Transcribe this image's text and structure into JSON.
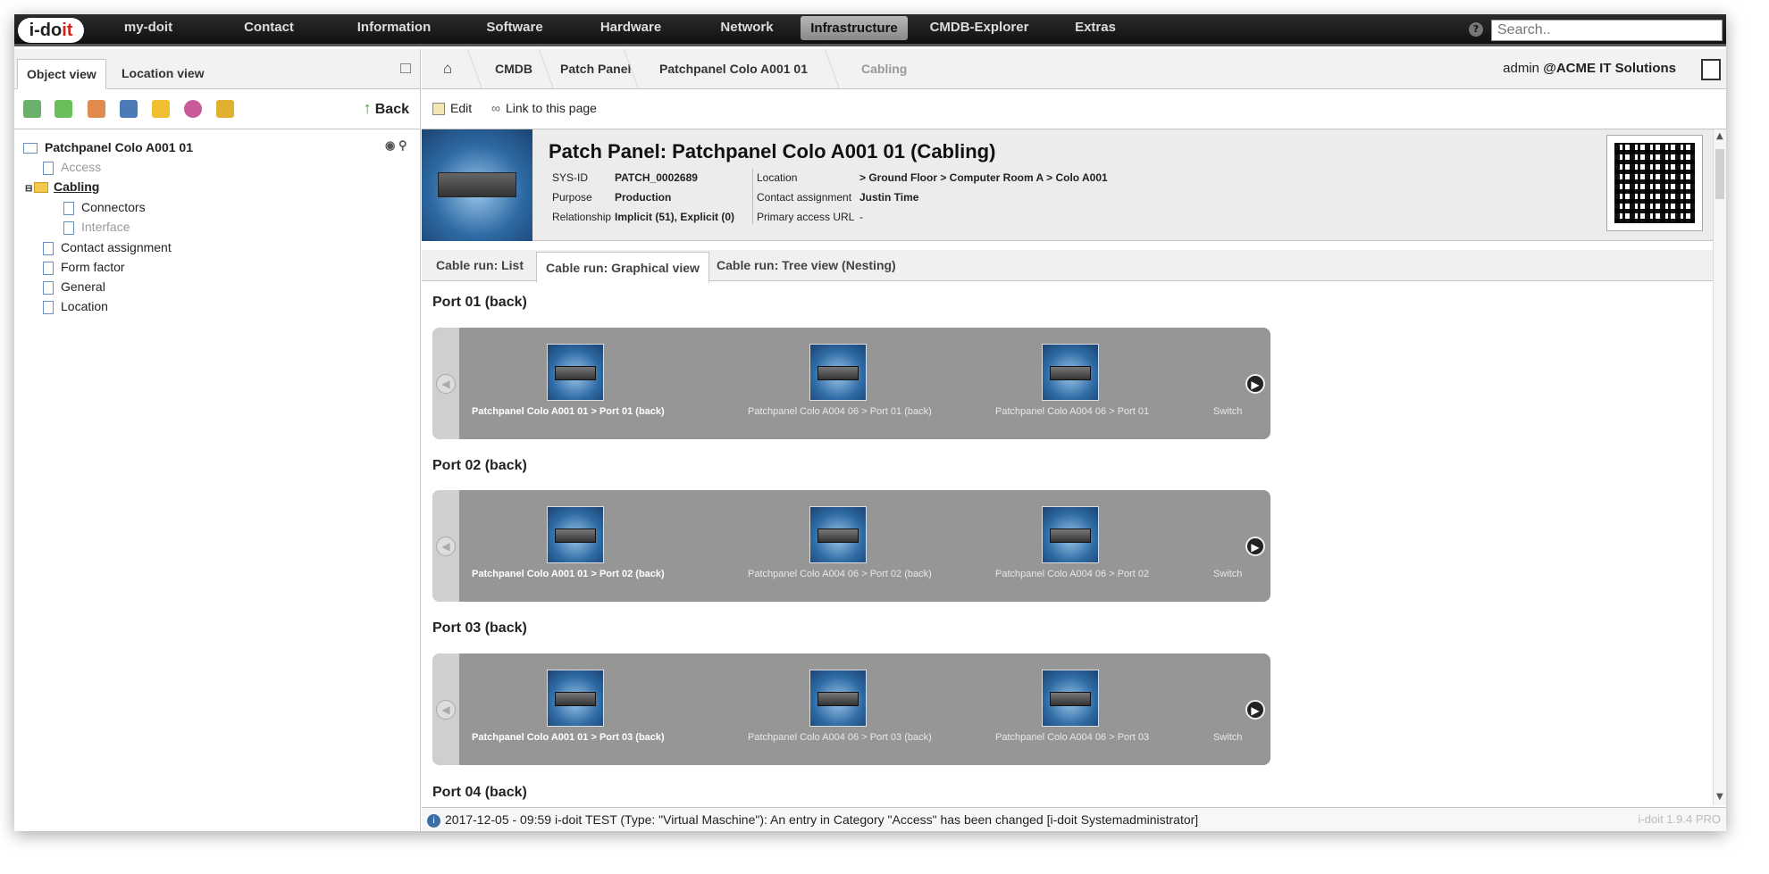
{
  "app": {
    "logo_main": "i-do",
    "logo_accent": "it"
  },
  "nav": {
    "items": [
      "my-doit",
      "Contact",
      "Information",
      "Software",
      "Hardware",
      "Network",
      "Infrastructure",
      "CMDB-Explorer",
      "Extras"
    ],
    "active": "Infrastructure",
    "search_placeholder": "Search..",
    "help": "?"
  },
  "left": {
    "tabs": [
      "Object view",
      "Location view"
    ],
    "back_label": "Back",
    "tree": {
      "root": "Patchpanel Colo A001 01",
      "items": [
        {
          "label": "Access",
          "disabled": true
        },
        {
          "label": "Cabling",
          "active": true
        },
        {
          "label": "Connectors"
        },
        {
          "label": "Interface",
          "disabled": true
        },
        {
          "label": "Contact assignment"
        },
        {
          "label": "Form factor"
        },
        {
          "label": "General"
        },
        {
          "label": "Location"
        }
      ]
    }
  },
  "breadcrumb": [
    "CMDB",
    "Patch Panel",
    "Patchpanel Colo A001 01",
    "Cabling"
  ],
  "user": {
    "name": "admin",
    "tenant": "@ACME IT Solutions"
  },
  "actions": {
    "edit": "Edit",
    "link": "Link to this page"
  },
  "object": {
    "title": "Patch Panel: Patchpanel Colo A001 01 (Cabling)",
    "fields": {
      "sysid_label": "SYS-ID",
      "sysid": "PATCH_0002689",
      "purpose_label": "Purpose",
      "purpose": "Production",
      "relationship_label": "Relationship",
      "relationship": "Implicit (51), Explicit (0)",
      "location_label": "Location",
      "location": "> Ground Floor > Computer Room A > Colo A001",
      "contact_label": "Contact assignment",
      "contact": "Justin Time",
      "url_label": "Primary access URL",
      "url": "-"
    }
  },
  "content_tabs": [
    "Cable run: List",
    "Cable run: Graphical view",
    "Cable run: Tree view (Nesting)"
  ],
  "ports": [
    {
      "title": "Port 01 (back)",
      "labels": [
        "Patchpanel Colo A001 01 > Port 01 (back)",
        "Patchpanel Colo A004 06 > Port 01 (back)",
        "Patchpanel Colo A004 06 > Port 01",
        "Switch"
      ]
    },
    {
      "title": "Port 02 (back)",
      "labels": [
        "Patchpanel Colo A001 01 > Port 02 (back)",
        "Patchpanel Colo A004 06 > Port 02 (back)",
        "Patchpanel Colo A004 06 > Port 02",
        "Switch"
      ]
    },
    {
      "title": "Port 03 (back)",
      "labels": [
        "Patchpanel Colo A001 01 > Port 03 (back)",
        "Patchpanel Colo A004 06 > Port 03 (back)",
        "Patchpanel Colo A004 06 > Port 03",
        "Switch"
      ]
    },
    {
      "title": "Port 04 (back)"
    }
  ],
  "status": {
    "message": "2017-12-05 - 09:59 i-doit TEST (Type: \"Virtual Maschine\"): An entry in Category \"Access\" has been changed [i-doit Systemadministrator]",
    "version": "i-doit 1.9.4 PRO"
  }
}
